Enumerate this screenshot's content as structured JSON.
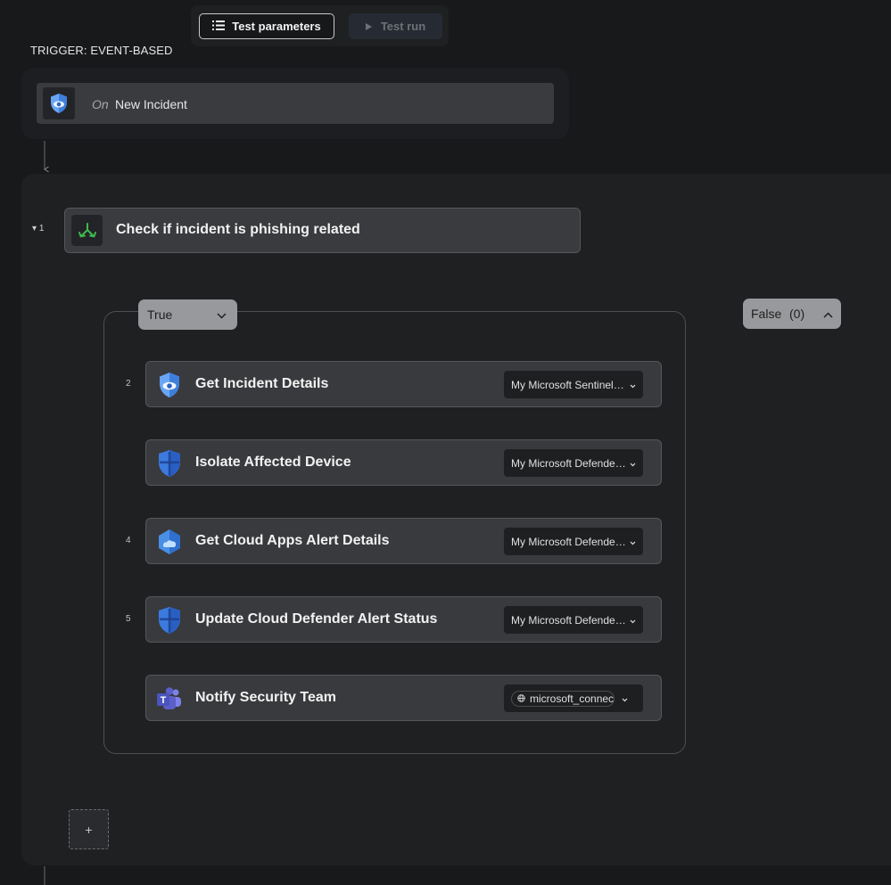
{
  "toolbar": {
    "test_parameters_label": "Test parameters",
    "test_run_label": "Test run"
  },
  "trigger": {
    "section_label": "TRIGGER: EVENT-BASED",
    "on_label": "On",
    "event_label": "New Incident"
  },
  "condition": {
    "step_number": "1",
    "title": "Check if incident is phishing related"
  },
  "branches": {
    "true_label": "True",
    "false_label": "False",
    "false_count": "(0)"
  },
  "steps": [
    {
      "number": "2",
      "title": "Get Incident Details",
      "connection": "My Microsoft Sentinel Connection",
      "icon": "sentinel-icon"
    },
    {
      "number": "",
      "title": "Isolate Affected Device",
      "connection": "My Microsoft Defender Connection",
      "icon": "defender-shield-icon"
    },
    {
      "number": "4",
      "title": "Get Cloud Apps Alert Details",
      "connection": "My Microsoft Defender Connection",
      "icon": "cloud-apps-icon"
    },
    {
      "number": "5",
      "title": "Update Cloud Defender Alert Status",
      "connection": "My Microsoft Defender Connection",
      "icon": "defender-shield-icon"
    },
    {
      "number": "",
      "title": "Notify Security Team",
      "connection": "microsoft_connection",
      "icon": "teams-icon"
    }
  ],
  "add_step_label": "+",
  "colors": {
    "background": "#18191b",
    "panel": "#1f2022",
    "card": "#393a3d",
    "pill": "#98999c",
    "accent_green": "#3fb950",
    "sentinel_blue": "#5b9bf0",
    "defender_blue": "#2f6fdc",
    "teams_purple": "#5b5fc7"
  }
}
